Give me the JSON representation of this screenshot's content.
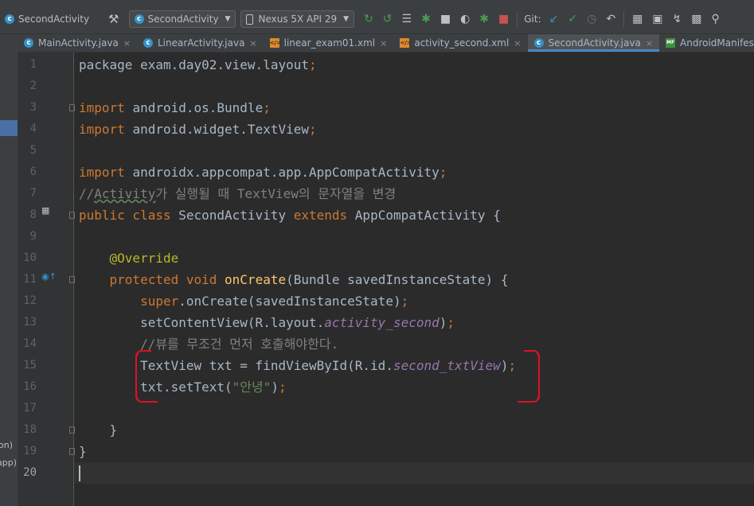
{
  "colors": {
    "background": "#2b2b2b",
    "keyword": "#cc7832",
    "annotation": "#bbb529",
    "method": "#ffc66d",
    "string": "#6a8759",
    "comment": "#808080",
    "field": "#9876aa",
    "plain": "#a9b7c6",
    "highlight_box": "#d9112a",
    "run_green": "#499c54",
    "stop_red": "#c75450",
    "git_blue": "#3592c4"
  },
  "toolbar": {
    "module_name": "SecondActivity",
    "hammer_icon": "hammer-icon",
    "run_config": "SecondActivity",
    "device": "Nexus 5X API 29",
    "git_label": "Git:",
    "icons": [
      "apply-changes-icon",
      "apply-code-changes-icon",
      "logcat-icon",
      "debug-icon",
      "attach-debugger-icon",
      "profile-icon",
      "run-with-coverage-icon",
      "stop-icon",
      "git-update-icon",
      "git-commit-icon",
      "git-history-icon",
      "rollback-icon",
      "project-structure-icon",
      "avd-manager-icon",
      "sdk-manager-icon",
      "layout-inspector-icon",
      "search-icon"
    ]
  },
  "tabs": [
    {
      "label": "MainActivity.java",
      "type": "java",
      "active": false
    },
    {
      "label": "LinearActivity.java",
      "type": "java",
      "active": false
    },
    {
      "label": "linear_exam01.xml",
      "type": "xml",
      "active": false
    },
    {
      "label": "activity_second.xml",
      "type": "xml",
      "active": false
    },
    {
      "label": "SecondActivity.java",
      "type": "java",
      "active": true
    },
    {
      "label": "AndroidManifest.xml",
      "type": "manifest",
      "active": false
    }
  ],
  "left_panel_fragments": [
    "on)",
    "app)"
  ],
  "editor": {
    "current_line": 20,
    "line_numbers": [
      "1",
      "2",
      "3",
      "4",
      "5",
      "6",
      "7",
      "8",
      "9",
      "10",
      "11",
      "12",
      "13",
      "14",
      "15",
      "16",
      "17",
      "18",
      "19",
      "20"
    ],
    "lines": [
      [
        {
          "t": "package exam.day02.view.layout",
          "c": "plain"
        },
        {
          "t": ";",
          "c": "kw"
        }
      ],
      [],
      [
        {
          "t": "import ",
          "c": "kw"
        },
        {
          "t": "android.os.Bundle",
          "c": "plain"
        },
        {
          "t": ";",
          "c": "kw"
        }
      ],
      [
        {
          "t": "import ",
          "c": "kw"
        },
        {
          "t": "android.widget.TextView",
          "c": "plain"
        },
        {
          "t": ";",
          "c": "kw"
        }
      ],
      [],
      [
        {
          "t": "import ",
          "c": "kw"
        },
        {
          "t": "androidx.appcompat.app.AppCompatActivity",
          "c": "plain"
        },
        {
          "t": ";",
          "c": "kw"
        }
      ],
      [
        {
          "t": "//",
          "c": "cmt"
        },
        {
          "t": "Activity",
          "c": "cmt squig"
        },
        {
          "t": "가 실행될 때 TextView의 문자열을 변경",
          "c": "cmt"
        }
      ],
      [
        {
          "t": "public class ",
          "c": "kw"
        },
        {
          "t": "SecondActivity ",
          "c": "plain"
        },
        {
          "t": "extends ",
          "c": "kw"
        },
        {
          "t": "AppCompatActivity {",
          "c": "plain"
        }
      ],
      [],
      [
        {
          "t": "    ",
          "c": "plain"
        },
        {
          "t": "@Override",
          "c": "ann"
        }
      ],
      [
        {
          "t": "    ",
          "c": "plain"
        },
        {
          "t": "protected void ",
          "c": "kw"
        },
        {
          "t": "onCreate",
          "c": "fn"
        },
        {
          "t": "(Bundle savedInstanceState) {",
          "c": "plain"
        }
      ],
      [
        {
          "t": "        ",
          "c": "plain"
        },
        {
          "t": "super",
          "c": "kw"
        },
        {
          "t": ".onCreate(savedInstanceState)",
          "c": "plain"
        },
        {
          "t": ";",
          "c": "kw"
        }
      ],
      [
        {
          "t": "        setContentView(R.layout.",
          "c": "plain"
        },
        {
          "t": "activity_second",
          "c": "ital"
        },
        {
          "t": ")",
          "c": "plain"
        },
        {
          "t": ";",
          "c": "kw"
        }
      ],
      [
        {
          "t": "        ",
          "c": "plain"
        },
        {
          "t": "//뷰를 무조건 먼저 호출해야한다.",
          "c": "cmt"
        }
      ],
      [
        {
          "t": "        TextView txt = findViewById(R.id.",
          "c": "plain"
        },
        {
          "t": "second_txtView",
          "c": "ital"
        },
        {
          "t": ")",
          "c": "plain"
        },
        {
          "t": ";",
          "c": "kw"
        }
      ],
      [
        {
          "t": "        txt.setText(",
          "c": "plain"
        },
        {
          "t": "\"안녕\"",
          "c": "str"
        },
        {
          "t": ")",
          "c": "plain"
        },
        {
          "t": ";",
          "c": "kw"
        }
      ],
      [],
      [
        {
          "t": "    }",
          "c": "plain"
        }
      ],
      [
        {
          "t": "}",
          "c": "plain"
        }
      ],
      []
    ]
  }
}
